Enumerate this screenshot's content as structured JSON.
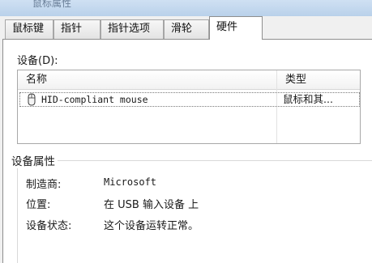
{
  "window": {
    "title_fragment": "鼠标属性"
  },
  "tabs": [
    {
      "label": "鼠标键"
    },
    {
      "label": "指针"
    },
    {
      "label": "指针选项"
    },
    {
      "label": "滑轮"
    },
    {
      "label": "硬件"
    }
  ],
  "active_tab": "硬件",
  "devices": {
    "label": "设备(D):",
    "columns": [
      {
        "label": "名称"
      },
      {
        "label": "类型"
      }
    ],
    "rows": [
      {
        "name": "HID-compliant mouse",
        "type": "鼠标和其...",
        "icon": "mouse-icon",
        "selected": true
      }
    ]
  },
  "properties": {
    "title": "设备属性",
    "manufacturer_label": "制造商:",
    "manufacturer_value": "Microsoft",
    "location_label": "位置:",
    "location_value": "在 USB 输入设备 上",
    "status_label": "设备状态:",
    "status_value": "这个设备运转正常。"
  }
}
